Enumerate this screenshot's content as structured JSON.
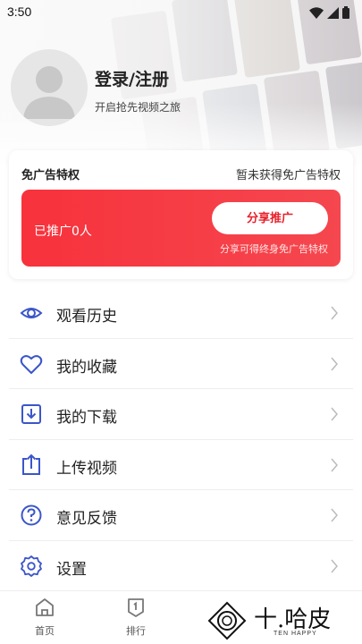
{
  "status_bar": {
    "time": "3:50"
  },
  "profile": {
    "login_title": "登录/注册",
    "login_subtitle": "开启抢先视频之旅"
  },
  "adfree": {
    "title": "免广告特权",
    "status": "暂未获得免广告特权",
    "promo_count": "已推广0人",
    "share_button": "分享推广",
    "promo_note": "分享可得终身免广告特权"
  },
  "menu": {
    "items": [
      {
        "label": "观看历史",
        "icon": "eye-icon"
      },
      {
        "label": "我的收藏",
        "icon": "heart-icon"
      },
      {
        "label": "我的下载",
        "icon": "download-icon"
      },
      {
        "label": "上传视频",
        "icon": "upload-icon"
      },
      {
        "label": "意见反馈",
        "icon": "question-icon"
      },
      {
        "label": "设置",
        "icon": "gear-icon"
      }
    ]
  },
  "bottom_nav": {
    "items": [
      {
        "label": "首页",
        "icon": "home-icon"
      },
      {
        "label": "排行",
        "icon": "ranking-icon"
      }
    ]
  },
  "watermark": {
    "text": "十.哈皮",
    "sub": "TEN HAPPY"
  },
  "colors": {
    "accent": "#3b56c9",
    "promo_red": "#f5343e",
    "share_text": "#e8202b"
  }
}
